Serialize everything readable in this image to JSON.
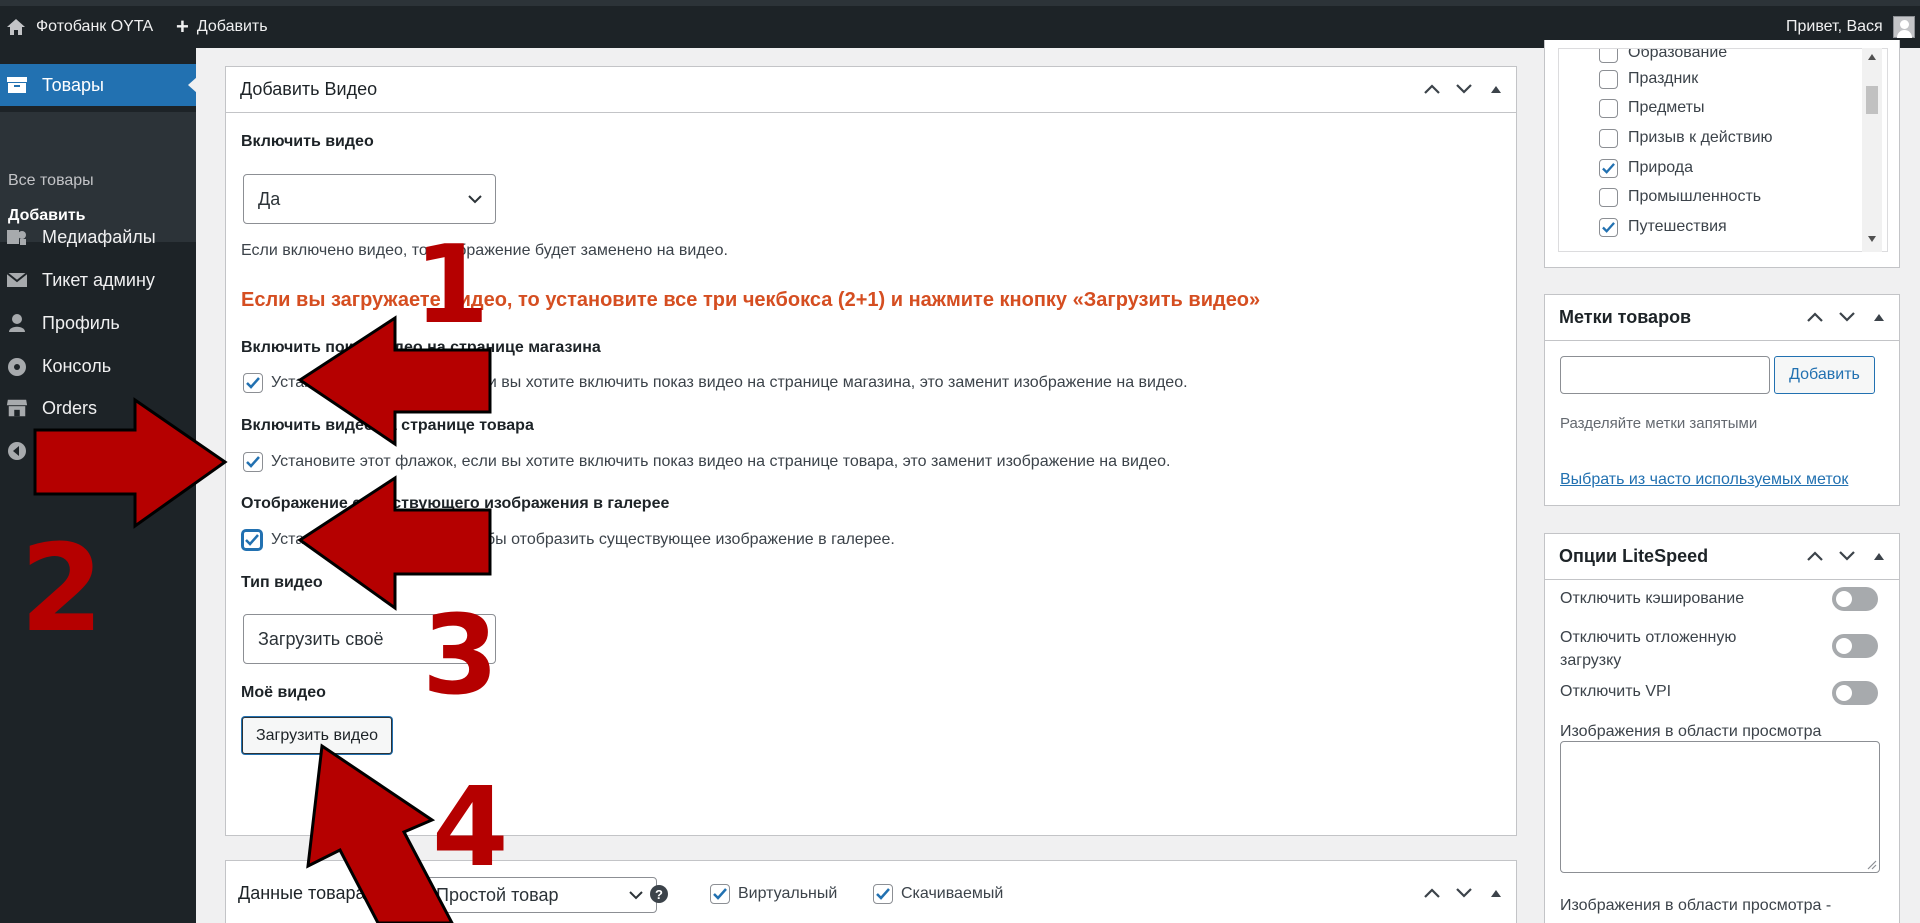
{
  "adminbar": {
    "site_name": "Фотобанк OYTA",
    "add_label": "Добавить",
    "greeting": "Привет, Вася"
  },
  "sidebar": {
    "active_item": "Товары",
    "submenu": [
      "Все товары",
      "Добавить"
    ],
    "items": [
      "Медиафайлы",
      "Тикет админу",
      "Профиль",
      "Консоль",
      "Orders"
    ],
    "collapse": "Свернуть меню"
  },
  "video_box": {
    "title": "Добавить Видео",
    "enable_label": "Включить видео",
    "enable_value": "Да",
    "enable_desc": "Если включено видео, то изображение будет заменено на видео.",
    "warning": "Если вы загружаете видео, то установите все три чекбокса (2+1) и нажмите кнопку «Загрузить видео»",
    "shop_label": "Включить показ видео на странице магазина",
    "shop_text": "Установите этот флажок, если вы хотите включить показ видео на странице магазина, это заменит изображение на видео.",
    "product_label": "Включить видео на странице товара",
    "product_text": "Установите этот флажок, если вы хотите включить показ видео на странице товара, это заменит изображение на видео.",
    "gallery_label": "Отображение существующего изображения в галерее",
    "gallery_text": "Установите этот флажок, чтобы отобразить существующее изображение в галерее.",
    "type_label": "Тип видео",
    "type_value": "Загрузить своё",
    "my_video_label": "Моё видео",
    "upload_button": "Загрузить видео"
  },
  "product_data": {
    "title": "Данные товара —",
    "type_value": "Простой товар",
    "help_icon": "?",
    "virtual_label": "Виртуальный",
    "downloadable_label": "Скачиваемый"
  },
  "categories": [
    {
      "label": "Образование",
      "checked": false
    },
    {
      "label": "Праздник",
      "checked": false
    },
    {
      "label": "Предметы",
      "checked": false
    },
    {
      "label": "Призыв к действию",
      "checked": false
    },
    {
      "label": "Природа",
      "checked": true
    },
    {
      "label": "Промышленность",
      "checked": false
    },
    {
      "label": "Путешествия",
      "checked": true
    }
  ],
  "tags_box": {
    "title": "Метки товаров",
    "add_button": "Добавить",
    "hint": "Разделяйте метки запятыми",
    "popular_link": "Выбрать из часто используемых меток"
  },
  "litespeed": {
    "title": "Опции LiteSpeed",
    "opt_cache": "Отключить кэширование",
    "opt_lazy": "Отключить отложенную загрузку",
    "opt_vpi": "Отключить VPI",
    "viewport_label": "Изображения в области просмотра",
    "viewport_mobile_label": "Изображения в области просмотра -"
  },
  "annotations": {
    "n1": "1",
    "n2": "2",
    "n3": "3",
    "n4": "4"
  },
  "colors": {
    "admin_dark": "#1d2327",
    "accent": "#2271b1",
    "warning": "#d54e21",
    "annotation": "#b50000"
  }
}
